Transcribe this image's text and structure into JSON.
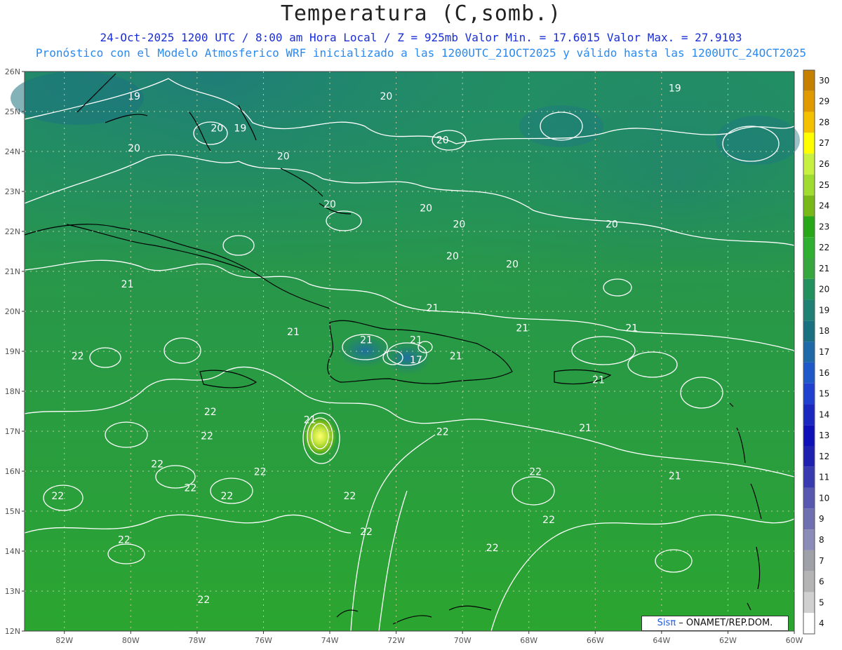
{
  "title": "Temperatura (C,somb.)",
  "subtitle_line1": "24-Oct-2025   1200 UTC / 8:00 am Hora Local / Z = 925mb     Valor Min. = 17.6015  Valor Max. = 27.9103",
  "subtitle_line2": "Pronóstico con el Modelo Atmosferico WRF inicializado a las 1200UTC_21OCT2025 y válido hasta las  1200UTC_24OCT2025",
  "credit": {
    "sis": "Sis",
    "pi": "π",
    "rest": "– ONAMET/REP.DOM."
  },
  "axes": {
    "lat_labels": [
      "26N",
      "25N",
      "24N",
      "23N",
      "22N",
      "21N",
      "20N",
      "19N",
      "18N",
      "17N",
      "16N",
      "15N",
      "14N",
      "13N",
      "12N"
    ],
    "lon_labels": [
      "82W",
      "80W",
      "78W",
      "76W",
      "74W",
      "72W",
      "70W",
      "68W",
      "66W",
      "64W",
      "62W",
      "60W"
    ],
    "lat_range": [
      12,
      26
    ],
    "lon_range": [
      -83.2,
      -60
    ]
  },
  "colorbar": {
    "levels": [
      "30",
      "29",
      "28",
      "27",
      "26",
      "25",
      "24",
      "23",
      "22",
      "21",
      "20",
      "19",
      "18",
      "17",
      "16",
      "15",
      "14",
      "13",
      "12",
      "11",
      "10",
      "9",
      "8",
      "7",
      "6",
      "5",
      "4"
    ],
    "colors": [
      "#c68000",
      "#e09a00",
      "#f5c000",
      "#ffff00",
      "#c8f040",
      "#a0dc30",
      "#78b818",
      "#28a818",
      "#30b030",
      "#36a63e",
      "#239060",
      "#1f8074",
      "#197080",
      "#1e6aa8",
      "#1f58c8",
      "#2040d0",
      "#1a28c0",
      "#1010b8",
      "#2020b0",
      "#3a3ab0",
      "#5858b0",
      "#7070b0",
      "#8c8cb8",
      "#a0a0a8",
      "#b4b4b4",
      "#d0d0d0",
      "#ffffff"
    ]
  },
  "contour_labels": [
    {
      "text": "19",
      "lon": -76.7,
      "lat": 24.5
    },
    {
      "text": "19",
      "lon": -79.9,
      "lat": 25.3
    },
    {
      "text": "19",
      "lon": -63.6,
      "lat": 25.5
    },
    {
      "text": "20",
      "lon": -79.9,
      "lat": 24.0
    },
    {
      "text": "20",
      "lon": -77.4,
      "lat": 24.5
    },
    {
      "text": "20",
      "lon": -75.4,
      "lat": 23.8
    },
    {
      "text": "20",
      "lon": -74.0,
      "lat": 22.6
    },
    {
      "text": "20",
      "lon": -72.3,
      "lat": 25.3
    },
    {
      "text": "20",
      "lon": -70.6,
      "lat": 24.2
    },
    {
      "text": "20",
      "lon": -71.1,
      "lat": 22.5
    },
    {
      "text": "20",
      "lon": -70.1,
      "lat": 22.1
    },
    {
      "text": "20",
      "lon": -70.3,
      "lat": 21.3
    },
    {
      "text": "20",
      "lon": -68.5,
      "lat": 21.1
    },
    {
      "text": "20",
      "lon": -65.5,
      "lat": 22.1
    },
    {
      "text": "21",
      "lon": -80.1,
      "lat": 20.6
    },
    {
      "text": "21",
      "lon": -75.1,
      "lat": 19.4
    },
    {
      "text": "21",
      "lon": -72.9,
      "lat": 19.2
    },
    {
      "text": "21",
      "lon": -71.4,
      "lat": 19.2
    },
    {
      "text": "21",
      "lon": -70.9,
      "lat": 20.0
    },
    {
      "text": "21",
      "lon": -70.2,
      "lat": 18.8
    },
    {
      "text": "21",
      "lon": -68.2,
      "lat": 19.5
    },
    {
      "text": "21",
      "lon": -64.9,
      "lat": 19.5
    },
    {
      "text": "21",
      "lon": -65.9,
      "lat": 18.2
    },
    {
      "text": "21",
      "lon": -66.3,
      "lat": 17.0
    },
    {
      "text": "21",
      "lon": -74.6,
      "lat": 17.2
    },
    {
      "text": "21",
      "lon": -63.6,
      "lat": 15.8
    },
    {
      "text": "17",
      "lon": -71.4,
      "lat": 18.7
    },
    {
      "text": "22",
      "lon": -81.6,
      "lat": 18.8
    },
    {
      "text": "22",
      "lon": -77.6,
      "lat": 17.4
    },
    {
      "text": "22",
      "lon": -77.7,
      "lat": 16.8
    },
    {
      "text": "22",
      "lon": -79.2,
      "lat": 16.1
    },
    {
      "text": "22",
      "lon": -76.1,
      "lat": 15.9
    },
    {
      "text": "22",
      "lon": -78.2,
      "lat": 15.5
    },
    {
      "text": "22",
      "lon": -77.1,
      "lat": 15.3
    },
    {
      "text": "22",
      "lon": -82.2,
      "lat": 15.3
    },
    {
      "text": "22",
      "lon": -73.4,
      "lat": 15.3
    },
    {
      "text": "22",
      "lon": -72.9,
      "lat": 14.4
    },
    {
      "text": "22",
      "lon": -70.6,
      "lat": 16.9
    },
    {
      "text": "22",
      "lon": -67.8,
      "lat": 15.9
    },
    {
      "text": "22",
      "lon": -67.4,
      "lat": 14.7
    },
    {
      "text": "22",
      "lon": -69.1,
      "lat": 14.0
    },
    {
      "text": "22",
      "lon": -80.2,
      "lat": 14.2
    },
    {
      "text": "22",
      "lon": -77.8,
      "lat": 12.7
    }
  ]
}
